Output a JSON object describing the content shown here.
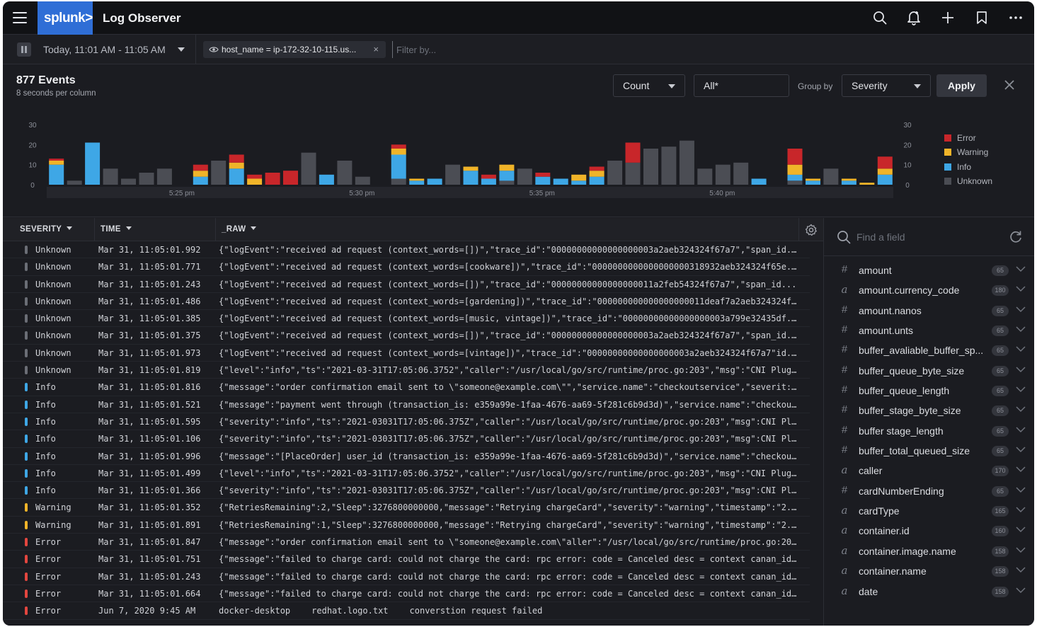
{
  "app": {
    "logo": "splunk>",
    "title": "Log Observer"
  },
  "filterbar": {
    "time_range": "Today, 11:01 AM - 11:05 AM",
    "chip_label": "host_name = ip-172-32-10-115.us...",
    "chip_close": "×",
    "filter_placeholder": "Filter by..."
  },
  "summary": {
    "count": "877 Events",
    "resolution": "8 seconds per column"
  },
  "controls": {
    "aggregate": "Count",
    "field_value": "All*",
    "group_by_label": "Group by",
    "group_by_value": "Severity",
    "apply_label": "Apply"
  },
  "chart_data": {
    "type": "bar",
    "stacked": true,
    "y_axis_ticks": [
      "0",
      "10",
      "20",
      "30"
    ],
    "ylim": [
      0,
      30
    ],
    "x_tick_labels": [
      "5:25 pm",
      "5:30 pm",
      "5:35 pm",
      "5:40 pm"
    ],
    "x_tick_positions": [
      7,
      17,
      27,
      37
    ],
    "series": [
      {
        "name": "Error",
        "color": "#c8262a",
        "values": [
          1,
          0,
          0,
          0,
          0,
          0,
          0,
          0,
          3,
          0,
          4,
          2,
          6,
          7,
          0,
          0,
          0,
          0,
          0,
          2,
          0,
          0,
          0,
          0,
          2,
          0,
          0,
          2,
          0,
          0,
          2,
          0,
          10,
          0,
          0,
          0,
          0,
          0,
          0,
          0,
          0,
          8,
          0,
          0,
          0,
          0,
          6
        ]
      },
      {
        "name": "Warning",
        "color": "#f0b429",
        "values": [
          2,
          0,
          0,
          0,
          0,
          0,
          0,
          0,
          3,
          0,
          3,
          3,
          0,
          0,
          0,
          0,
          0,
          0,
          0,
          3,
          1,
          0,
          0,
          2,
          0,
          3,
          0,
          0,
          0,
          3,
          3,
          0,
          0,
          0,
          0,
          0,
          0,
          0,
          0,
          0,
          0,
          5,
          1,
          0,
          1,
          1,
          3
        ]
      },
      {
        "name": "Info",
        "color": "#3ea7e6",
        "values": [
          10,
          0,
          21,
          0,
          0,
          0,
          0,
          0,
          4,
          0,
          8,
          0,
          0,
          0,
          0,
          5,
          0,
          0,
          0,
          12,
          2,
          3,
          0,
          7,
          3,
          5,
          0,
          4,
          3,
          2,
          4,
          0,
          0,
          0,
          0,
          0,
          0,
          0,
          0,
          3,
          0,
          3,
          2,
          0,
          2,
          0,
          5
        ]
      },
      {
        "name": "Unknown",
        "color": "#4b4d54",
        "values": [
          0,
          2,
          0,
          8,
          3,
          6,
          8,
          0,
          0,
          12,
          0,
          0,
          0,
          0,
          16,
          0,
          12,
          4,
          0,
          3,
          0,
          0,
          10,
          0,
          0,
          2,
          8,
          0,
          0,
          0,
          0,
          12,
          11,
          18,
          19,
          22,
          8,
          10,
          11,
          0,
          0,
          2,
          0,
          8,
          0,
          0,
          0
        ]
      }
    ]
  },
  "table": {
    "columns": {
      "severity": "SEVERITY",
      "time": "TIME",
      "raw": "_RAW"
    },
    "rows": [
      {
        "severity": "Unknown",
        "color": "#6b6e76",
        "time": "Mar 31, 11:05:01.992",
        "raw": "{\"logEvent\":\"received ad request (context_words=[])\",\"trace_id\":\"00000000000000000003a2aeb324324f67a7\",\"span_id..."
      },
      {
        "severity": "Unknown",
        "color": "#6b6e76",
        "time": "Mar 31, 11:05:01.771",
        "raw": "{\"logEvent\":\"received ad request (context_words=[cookware])\",\"trace_id\":\"0000000000000000000318932aeb324324f65e..."
      },
      {
        "severity": "Unknown",
        "color": "#6b6e76",
        "time": "Mar 31, 11:05:01.243",
        "raw": "{\"logEvent\":\"received ad request (context_words=[])\",\"trace_id\":\"00000000000000000011a2feb54324f67a7\",\"span_id..."
      },
      {
        "severity": "Unknown",
        "color": "#6b6e76",
        "time": "Mar 31, 11:05:01.486",
        "raw": "{\"logEvent\":\"received ad request (context_words=[gardening])\",\"trace_id\":\"000000000000000000011deaf7a2aeb324324f6..."
      },
      {
        "severity": "Unknown",
        "color": "#6b6e76",
        "time": "Mar 31, 11:05:01.385",
        "raw": "{\"logEvent\":\"received ad request (context_words=[music, vintage])\",\"trace_id\":\"00000000000000000003a799e32435df..."
      },
      {
        "severity": "Unknown",
        "color": "#6b6e76",
        "time": "Mar 31, 11:05:01.375",
        "raw": "{\"logEvent\":\"received ad request (context_words=[])\",\"trace_id\":\"00000000000000000003a2aeb324324f67a7\",\"span_id..."
      },
      {
        "severity": "Unknown",
        "color": "#6b6e76",
        "time": "Mar 31, 11:05:01.973",
        "raw": "{\"logEvent\":\"received ad request (context_words=[vintage])\",\"trace_id\":\"00000000000000000003a2aeb324324f67a7\"id..."
      },
      {
        "severity": "Unknown",
        "color": "#6b6e76",
        "time": "Mar 31, 11:05:01.819",
        "raw": "{\"level\":\"info\",\"ts\":\"2021-03-31T17:05:06.3752\",\"caller\":\"/usr/local/go/src/runtime/proc.go:203\",\"msg\":\"CNI Plug..."
      },
      {
        "severity": "Info",
        "color": "#3ea7e6",
        "time": "Mar 31, 11:05:01.816",
        "raw": "{\"message\":\"order confirmation email sent to \\\"someone@example.com\\\"\",\"service.name\":\"checkoutservice\",\"severit:..."
      },
      {
        "severity": "Info",
        "color": "#3ea7e6",
        "time": "Mar 31, 11:05:01.521",
        "raw": "{\"message\":\"payment went through (transaction_is: e359a99e-1faa-4676-aa69-5f281c6b9d3d)\",\"service.name\":\"checkou..."
      },
      {
        "severity": "Info",
        "color": "#3ea7e6",
        "time": "Mar 31, 11:05:01.595",
        "raw": "{\"severity\":\"info\",\"ts\":\"2021-03031T17:05:06.375Z\",\"caller\":\"/usr/local/go/src/runtime/proc.go:203\",\"msg\":CNI Pl..."
      },
      {
        "severity": "Info",
        "color": "#3ea7e6",
        "time": "Mar 31, 11:05:01.106",
        "raw": "{\"severity\":\"info\",\"ts\":\"2021-03031T17:05:06.375Z\",\"caller\":\"/usr/local/go/src/runtime/proc.go:203\",\"msg\":CNI Pl..."
      },
      {
        "severity": "Info",
        "color": "#3ea7e6",
        "time": "Mar 31, 11:05:01.996",
        "raw": "{\"message\":\"[PlaceOrder] user_id (transaction_is: e359a99e-1faa-4676-aa69-5f281c6b9d3d)\",\"service.name\":\"checkou..."
      },
      {
        "severity": "Info",
        "color": "#3ea7e6",
        "time": "Mar 31, 11:05:01.499",
        "raw": "{\"level\":\"info\",\"ts\":\"2021-03-31T17:05:06.3752\",\"caller\":\"/usr/local/go/src/runtime/proc.go:203\",\"msg\":\"CNI Plug..."
      },
      {
        "severity": "Info",
        "color": "#3ea7e6",
        "time": "Mar 31, 11:05:01.366",
        "raw": "{\"severity\":\"info\",\"ts\":\"2021-03031T17:05:06.375Z\",\"caller\":\"/usr/local/go/src/runtime/proc.go:203\",\"msg\":CNI Pl..."
      },
      {
        "severity": "Warning",
        "color": "#f0b429",
        "time": "Mar 31, 11:05:01.352",
        "raw": "{\"RetriesRemaining\":2,\"Sleep\":3276800000000,\"message\":\"Retrying chargeCard\",\"severity\":\"warning\",\"timestamp\":\"2..."
      },
      {
        "severity": "Warning",
        "color": "#f0b429",
        "time": "Mar 31, 11:05:01.891",
        "raw": "{\"RetriesRemaining\":1,\"Sleep\":3276800000000,\"message\":\"Retrying chargeCard\",\"severity\":\"warning\",\"timestamp\":\"2..."
      },
      {
        "severity": "Error",
        "color": "#e3463f",
        "time": "Mar 31, 11:05:01.847",
        "raw": "{\"message\":\"order confirmation email sent to \\\"someone@example.com\\\"aller\":\"/usr/local/go/src/runtime/proc.go:20,..."
      },
      {
        "severity": "Error",
        "color": "#e3463f",
        "time": "Mar 31, 11:05:01.751",
        "raw": "{\"message\":\"failed to charge card: could not charge the card: rpc error: code = Canceled desc = context canan_id..."
      },
      {
        "severity": "Error",
        "color": "#e3463f",
        "time": "Mar 31, 11:05:01.243",
        "raw": "{\"message\":\"failed to charge card: could not charge the card: rpc error: code = Canceled desc = context canan_id..."
      },
      {
        "severity": "Error",
        "color": "#e3463f",
        "time": "Mar 31, 11:05:01.664",
        "raw": "{\"message\":\"failed to charge card: could not charge the card: rpc error: code = Canceled desc = context canan_id..."
      },
      {
        "severity": "Error",
        "color": "#e3463f",
        "time": "Jun 7, 2020 9:45 AM",
        "raw_parts": [
          "docker-desktop",
          "redhat.logo.txt",
          "converstion request failed"
        ]
      }
    ]
  },
  "fields": {
    "search_placeholder": "Find a field",
    "items": [
      {
        "type": "#",
        "name": "amount",
        "count": "65"
      },
      {
        "type": "a",
        "name": "amount.currency_code",
        "count": "180"
      },
      {
        "type": "#",
        "name": "amount.nanos",
        "count": "65"
      },
      {
        "type": "#",
        "name": "amount.unts",
        "count": "65"
      },
      {
        "type": "#",
        "name": "buffer_avaliable_buffer_sp...",
        "count": "65"
      },
      {
        "type": "#",
        "name": "buffer_queue_byte_size",
        "count": "65"
      },
      {
        "type": "#",
        "name": "buffer_queue_length",
        "count": "65"
      },
      {
        "type": "#",
        "name": "buffer_stage_byte_size",
        "count": "65"
      },
      {
        "type": "#",
        "name": "buffer stage_length",
        "count": "65"
      },
      {
        "type": "#",
        "name": "buffer_total_queued_size",
        "count": "65"
      },
      {
        "type": "a",
        "name": "caller",
        "count": "170"
      },
      {
        "type": "#",
        "name": "cardNumberEnding",
        "count": "65"
      },
      {
        "type": "a",
        "name": "cardType",
        "count": "165"
      },
      {
        "type": "a",
        "name": "container.id",
        "count": "160"
      },
      {
        "type": "a",
        "name": "container.image.name",
        "count": "158"
      },
      {
        "type": "a",
        "name": "container.name",
        "count": "158"
      },
      {
        "type": "a",
        "name": "date",
        "count": "158"
      }
    ]
  }
}
